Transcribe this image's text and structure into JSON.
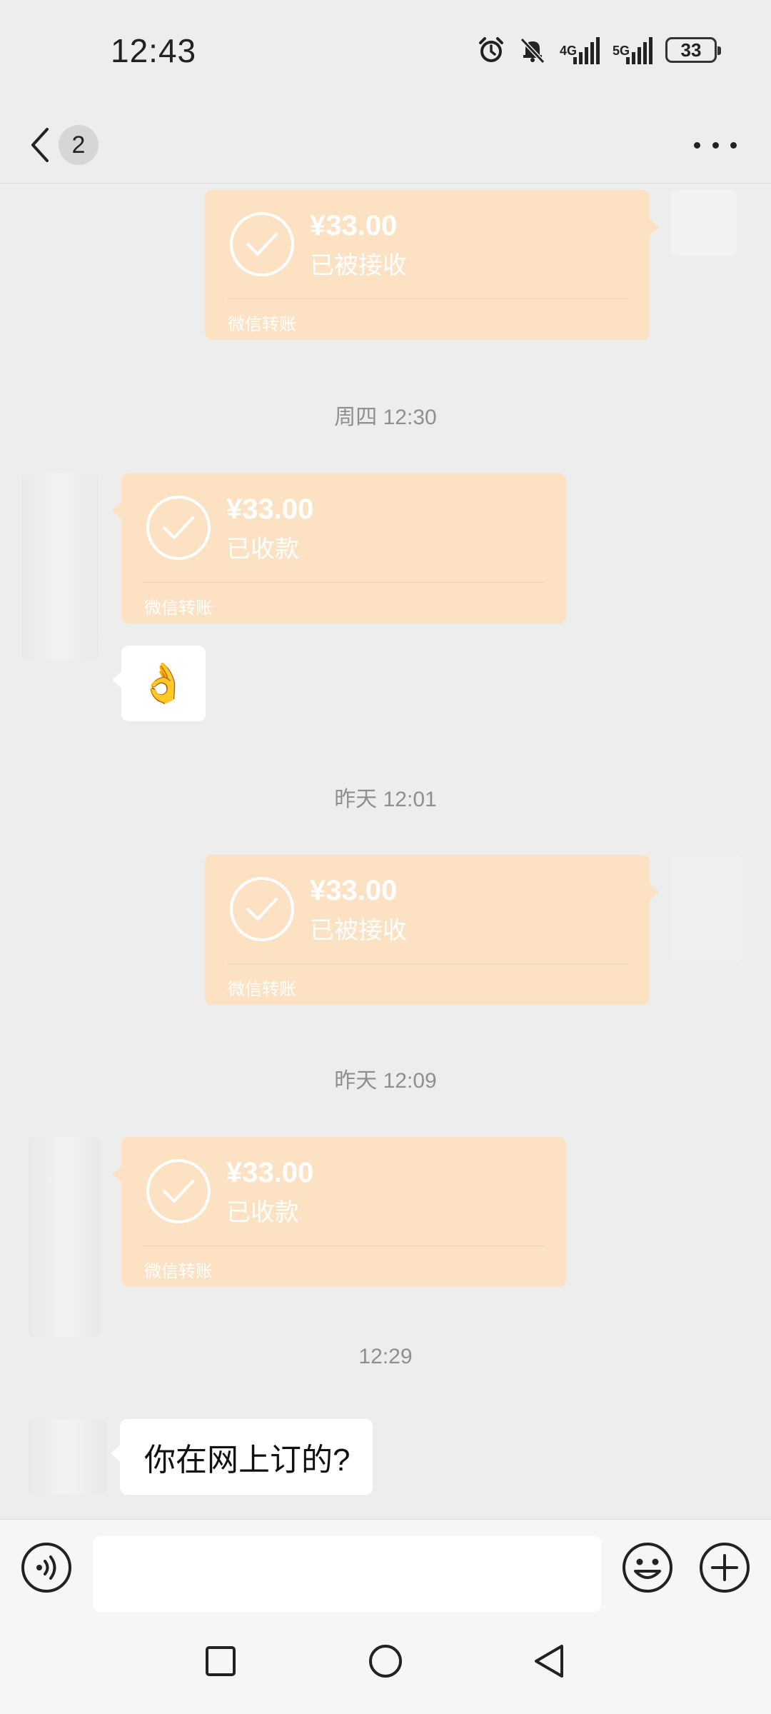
{
  "status_bar": {
    "time": "12:43",
    "signal_1_label": "4G",
    "signal_2_label": "5G",
    "battery": "33",
    "icons": [
      "alarm-icon",
      "mute-bell-icon",
      "signal-4g-icon",
      "signal-5g-icon",
      "battery-icon"
    ]
  },
  "header": {
    "unread_count": "2",
    "back_icon": "chevron-left-icon",
    "more_icon": "more-dots-icon"
  },
  "messages": [
    {
      "type": "transfer",
      "side": "right",
      "amount": "¥33.00",
      "status": "已被接收",
      "footer": "微信转账"
    },
    {
      "type": "timestamp",
      "text": "周四 12:30"
    },
    {
      "type": "transfer",
      "side": "left",
      "amount": "¥33.00",
      "status": "已收款",
      "footer": "微信转账"
    },
    {
      "type": "emoji",
      "side": "left",
      "text": "👌"
    },
    {
      "type": "timestamp",
      "text": "昨天 12:01"
    },
    {
      "type": "transfer",
      "side": "right",
      "amount": "¥33.00",
      "status": "已被接收",
      "footer": "微信转账"
    },
    {
      "type": "timestamp",
      "text": "昨天 12:09"
    },
    {
      "type": "transfer",
      "side": "left",
      "amount": "¥33.00",
      "status": "已收款",
      "footer": "微信转账"
    },
    {
      "type": "timestamp",
      "text": "12:29"
    },
    {
      "type": "text",
      "side": "left",
      "text": "你在网上订的?"
    }
  ],
  "input_bar": {
    "value": "",
    "placeholder": "",
    "icons": [
      "voice-icon",
      "emoji-icon",
      "plus-icon"
    ]
  },
  "nav_bar": {
    "icons": [
      "recent-apps-icon",
      "home-icon",
      "back-icon"
    ]
  },
  "colors": {
    "background": "#ededed",
    "transfer_bubble": "#fde1c3",
    "text_bubble": "#ffffff",
    "timestamp_text": "#8f8f8f"
  }
}
